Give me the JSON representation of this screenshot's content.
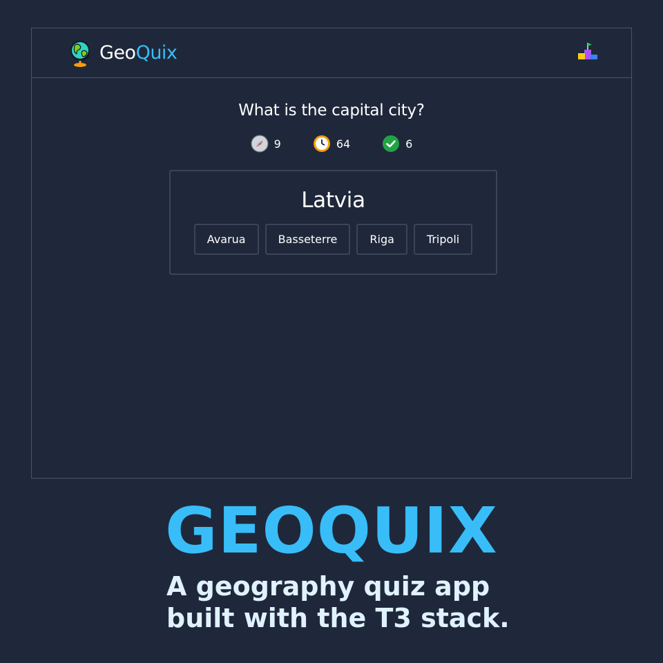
{
  "header": {
    "brand_part1": "Geo",
    "brand_part2": "Quix",
    "logo_icon": "globe-icon",
    "leaderboard_icon": "podium-icon"
  },
  "quiz": {
    "prompt": "What is the capital city?",
    "stats": [
      {
        "icon": "compass-icon",
        "value": "9"
      },
      {
        "icon": "clock-icon",
        "value": "64"
      },
      {
        "icon": "check-circle-icon",
        "value": "6"
      }
    ],
    "country": "Latvia",
    "options": [
      "Avarua",
      "Basseterre",
      "Riga",
      "Tripoli"
    ]
  },
  "promo": {
    "title": "GEOQUIX",
    "tagline_line1": "A geography quiz app",
    "tagline_line2": "built with the T3 stack."
  },
  "colors": {
    "background": "#1f283a",
    "accent": "#38bdf8",
    "border": "#3b4557",
    "success": "#22a344"
  }
}
